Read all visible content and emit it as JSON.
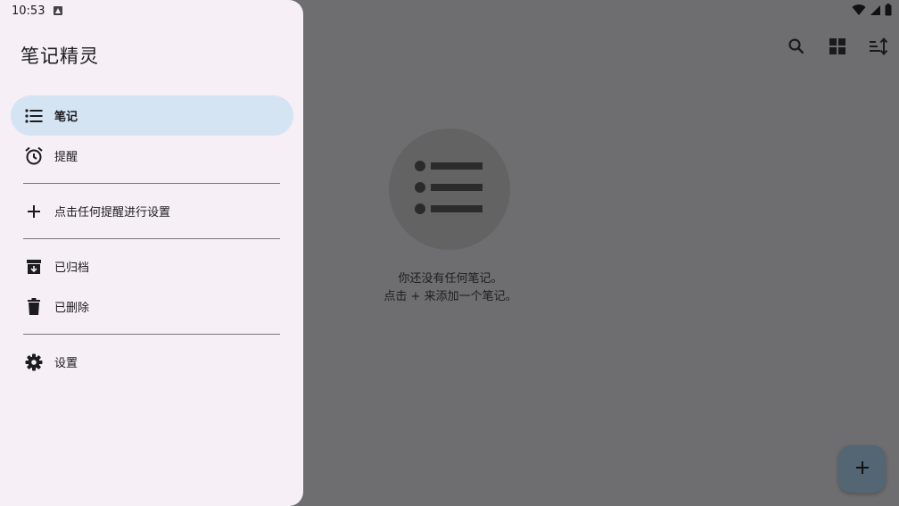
{
  "status_bar": {
    "time": "10:53",
    "icons": [
      "notification-icon",
      "wifi-icon",
      "signal-icon",
      "battery-icon"
    ]
  },
  "drawer": {
    "title": "笔记精灵",
    "items": [
      {
        "label": "笔记",
        "icon": "list-icon",
        "selected": true
      },
      {
        "label": "提醒",
        "icon": "alarm-icon",
        "selected": false
      },
      {
        "label": "点击任何提醒进行设置",
        "icon": "add-icon",
        "selected": false
      },
      {
        "label": "已归档",
        "icon": "archive-icon",
        "selected": false
      },
      {
        "label": "已删除",
        "icon": "trash-icon",
        "selected": false
      },
      {
        "label": "设置",
        "icon": "gear-icon",
        "selected": false
      }
    ]
  },
  "toolbar": {
    "icons": [
      "search-icon",
      "grid-view-icon",
      "sort-icon"
    ]
  },
  "empty_state": {
    "line1": "你还没有任何笔记。",
    "line2": "点击 + 来添加一个笔记。"
  },
  "fab": {
    "icon": "add-icon"
  },
  "colors": {
    "drawer_bg": "#f6eff6",
    "selected_item_bg": "#d4e4f3",
    "scrim_bg": "#6e6e70",
    "fab_bg": "#546574"
  }
}
